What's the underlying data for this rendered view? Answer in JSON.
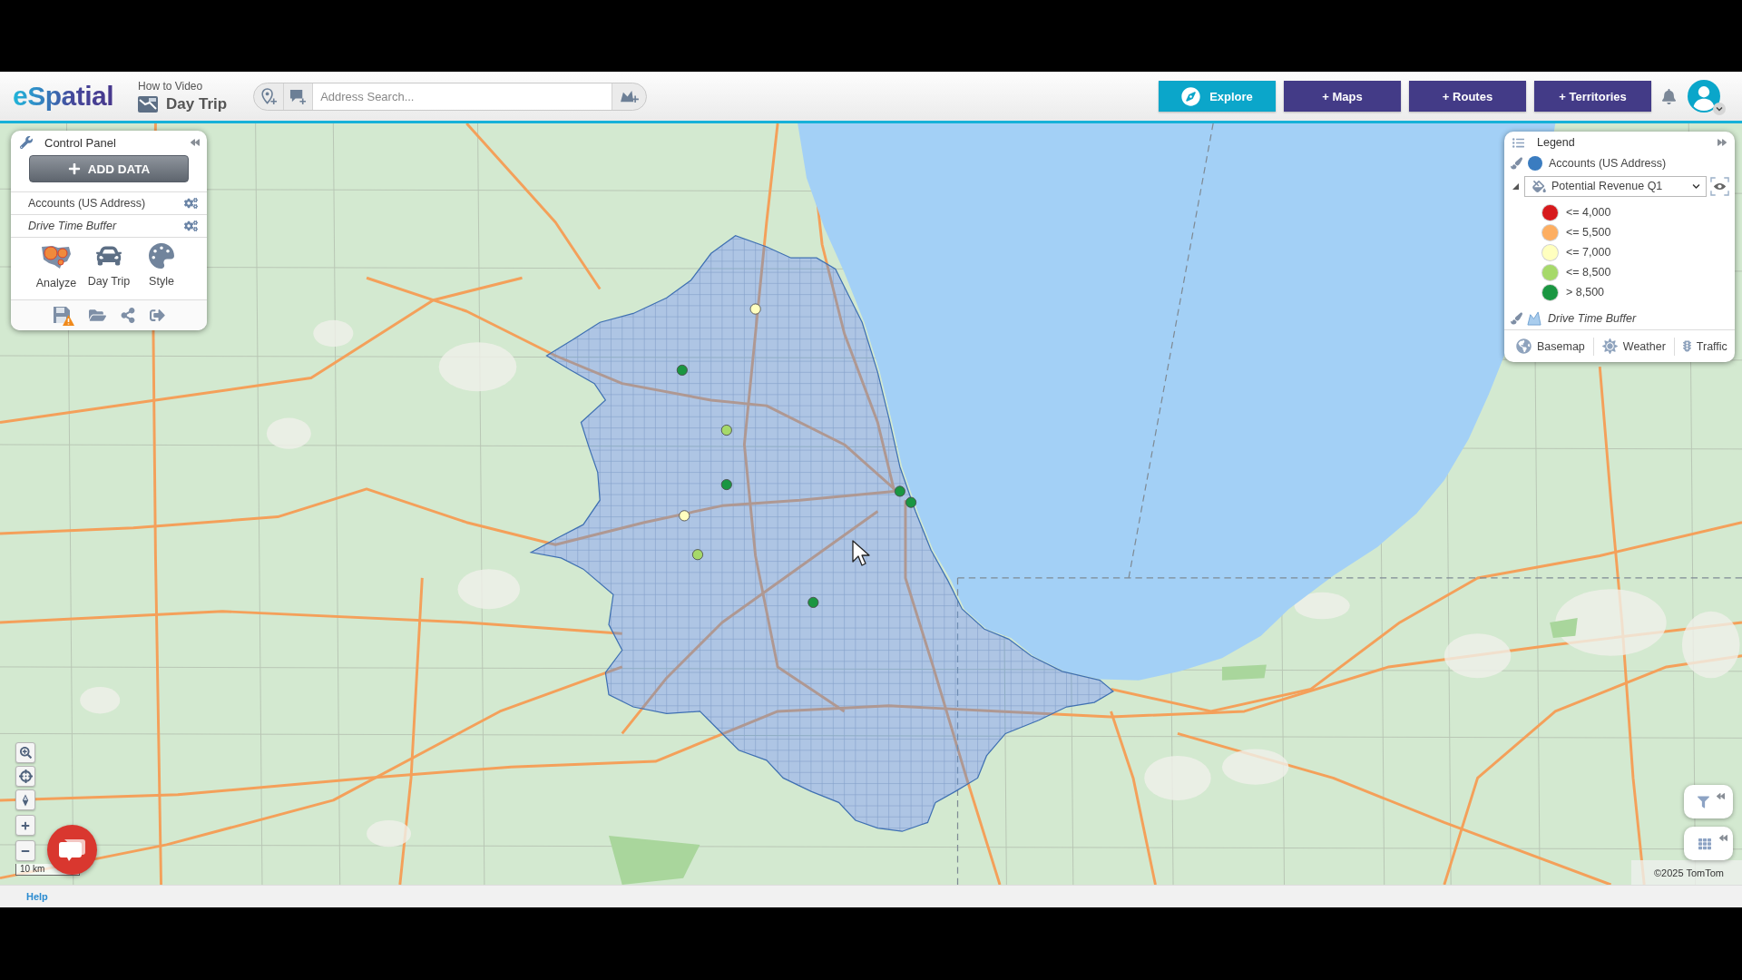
{
  "header": {
    "logo": "eSpatial",
    "video_label": "How to Video",
    "title": "Day Trip",
    "search": {
      "placeholder": "Address Search..."
    },
    "buttons": [
      {
        "label": "Explore",
        "kind": "explore"
      },
      {
        "label": "+ Maps",
        "kind": "add"
      },
      {
        "label": "+ Routes",
        "kind": "add"
      },
      {
        "label": "+ Territories",
        "kind": "add"
      }
    ]
  },
  "control_panel": {
    "title": "Control Panel",
    "add_data": "ADD DATA",
    "layers": [
      {
        "name": "Accounts (US Address)",
        "kind": "points"
      },
      {
        "name": "Drive Time Buffer",
        "kind": "buffer"
      }
    ],
    "tools": [
      {
        "label": "Analyze",
        "kind": "analyze"
      },
      {
        "label": "Day Trip",
        "kind": "day_trip"
      },
      {
        "label": "Style",
        "kind": "style"
      }
    ]
  },
  "legend": {
    "title": "Legend",
    "layers": [
      {
        "kind": "points",
        "name": "Accounts (US Address)",
        "color": "#3a7cc0",
        "style_field": "Potential Revenue Q1",
        "expanded": true,
        "ranges": [
          {
            "label": "<= 4,000",
            "color": "#d7191c"
          },
          {
            "label": "<= 5,500",
            "color": "#fdae61"
          },
          {
            "label": "<= 7,000",
            "color": "#ffffbf"
          },
          {
            "label": "<= 8,500",
            "color": "#a6d96a"
          },
          {
            "label": "> 8,500",
            "color": "#1a9641"
          }
        ]
      },
      {
        "kind": "buffer",
        "name": "Drive Time Buffer"
      }
    ],
    "tools": [
      {
        "label": "Basemap",
        "kind": "basemap"
      },
      {
        "label": "Weather",
        "kind": "weather"
      },
      {
        "label": "Traffic",
        "kind": "traffic"
      }
    ]
  },
  "map": {
    "markers": [
      {
        "color": "#ffffbf"
      },
      {
        "color": "#1a9641"
      },
      {
        "color": "#a6d96a"
      },
      {
        "color": "#1a9641"
      },
      {
        "color": "#ffffbf"
      },
      {
        "color": "#a6d96a"
      },
      {
        "color": "#1a9641"
      },
      {
        "color": "#1a9641"
      },
      {
        "color": "#1a9641"
      }
    ],
    "scale": "10 km",
    "attribution": "©2025 TomTom"
  },
  "footer": {
    "help": "Help"
  }
}
